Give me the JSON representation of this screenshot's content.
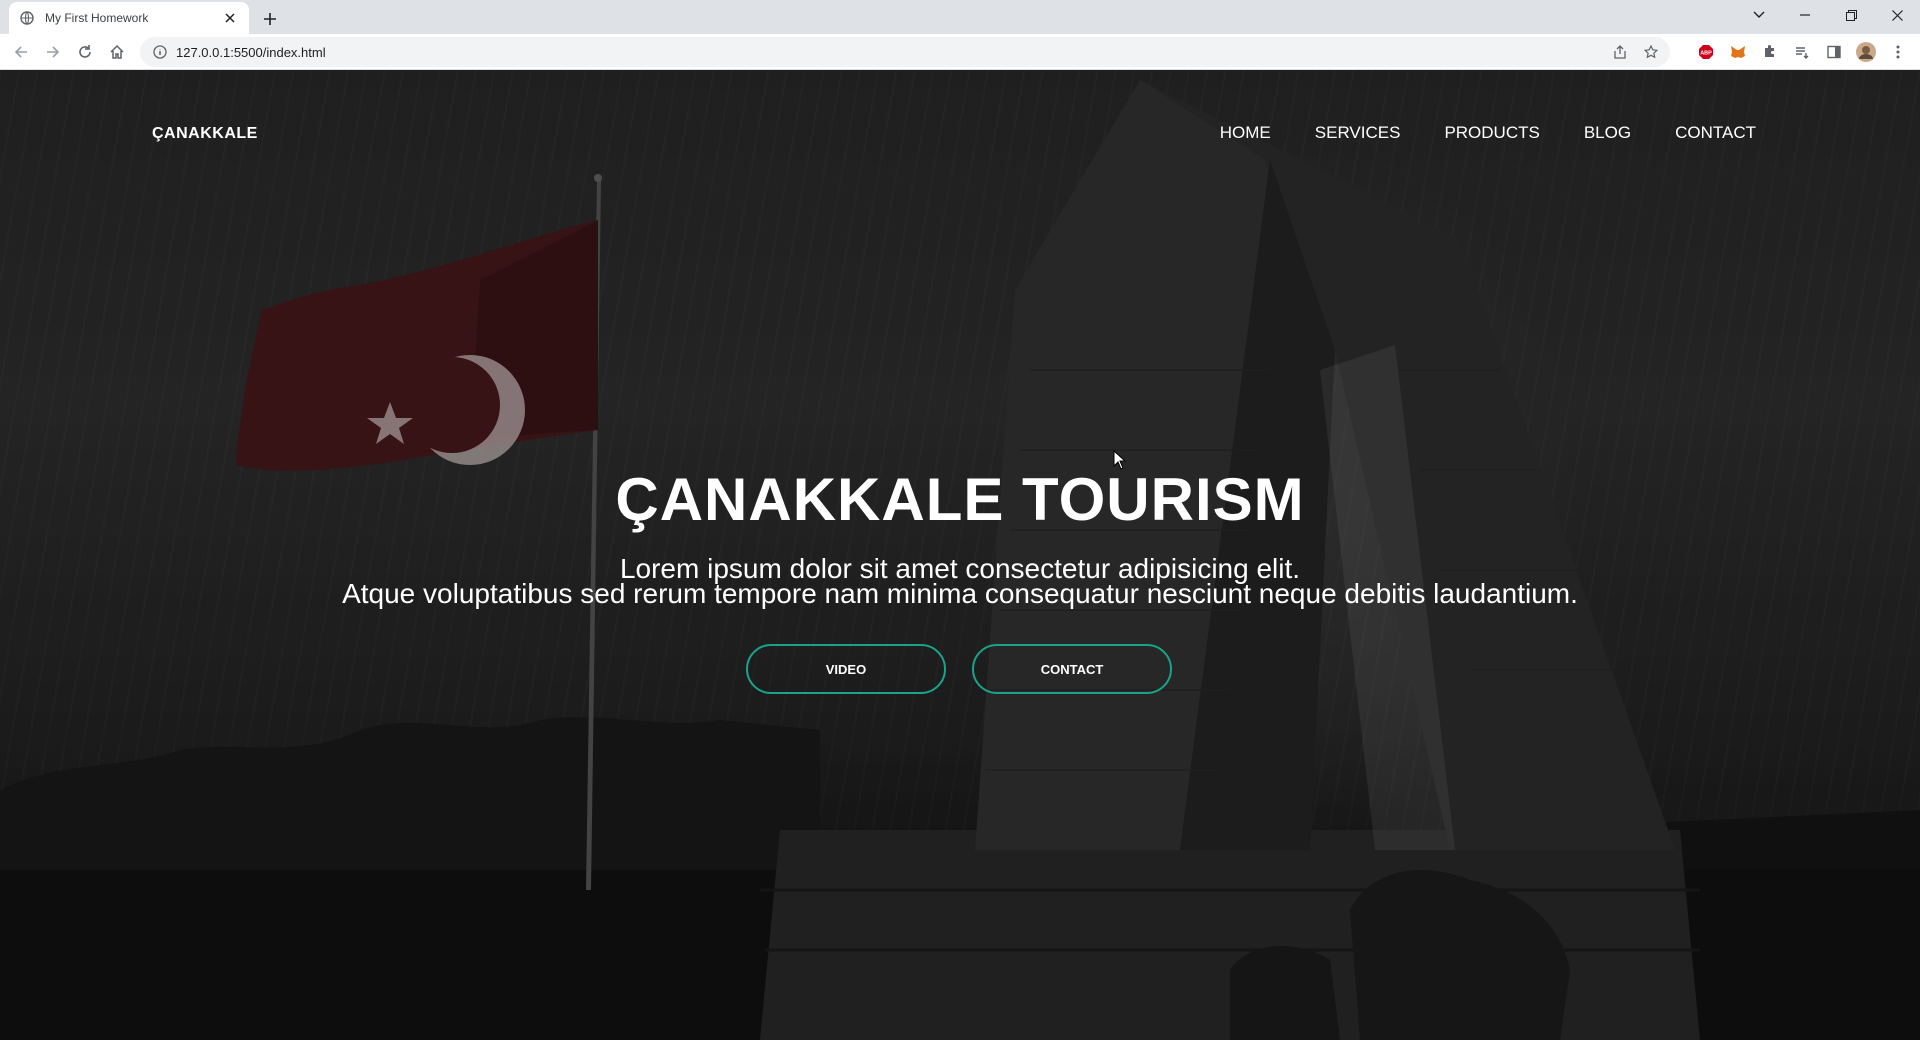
{
  "browser": {
    "tab_title": "My First Homework",
    "url": "127.0.0.1:5500/index.html"
  },
  "site": {
    "logo": "ÇANAKKALE",
    "nav": [
      "HOME",
      "SERVICES",
      "PRODUCTS",
      "BLOG",
      "CONTACT"
    ],
    "hero": {
      "title": "ÇANAKKALE TOURISM",
      "subtitle_line1": "Lorem ipsum dolor sit amet consectetur adipisicing elit.",
      "subtitle_line2": "Atque voluptatibus sed rerum tempore nam minima consequatur nesciunt neque debitis laudantium.",
      "buttons": [
        "VIDEO",
        "CONTACT"
      ]
    },
    "colors": {
      "button_border": "#18a38b",
      "text": "#ffffff"
    }
  }
}
